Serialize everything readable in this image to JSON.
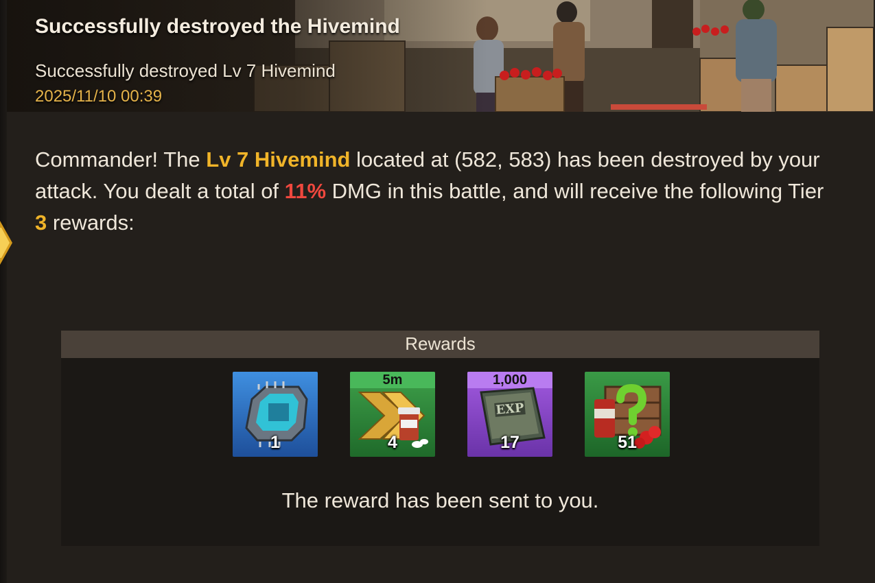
{
  "banner": {
    "title": "Successfully destroyed the Hivemind",
    "subtitle": "Successfully destroyed Lv 7 Hivemind",
    "timestamp": "2025/11/10 00:39"
  },
  "message": {
    "part1": "Commander! The ",
    "target": "Lv 7 Hivemind",
    "part2": " located at (582, 583) has been destroyed by your attack. You dealt a total of ",
    "damage": "11%",
    "part3": " DMG in this battle, and will receive the following Tier ",
    "tier": "3",
    "part4": " rewards:"
  },
  "rewards": {
    "header": "Rewards",
    "items": [
      {
        "icon": "chip-icon",
        "rarity": "blue",
        "tag": "",
        "count": "1"
      },
      {
        "icon": "speedup-medicine-icon",
        "rarity": "green",
        "tag": "5m",
        "count": "4"
      },
      {
        "icon": "exp-book-icon",
        "rarity": "purple",
        "tag": "1,000",
        "count": "17"
      },
      {
        "icon": "random-supply-crate-icon",
        "rarity": "green",
        "tag": "",
        "count": "51"
      }
    ],
    "note": "The reward has been sent to you."
  },
  "colors": {
    "background": "#231f1b",
    "accent_gold": "#f0b429",
    "accent_red": "#f0483e",
    "date_gold": "#e5b34a",
    "rarity_blue": "#2f74c8",
    "rarity_green": "#2e8a3a",
    "rarity_purple": "#8a47c9"
  }
}
